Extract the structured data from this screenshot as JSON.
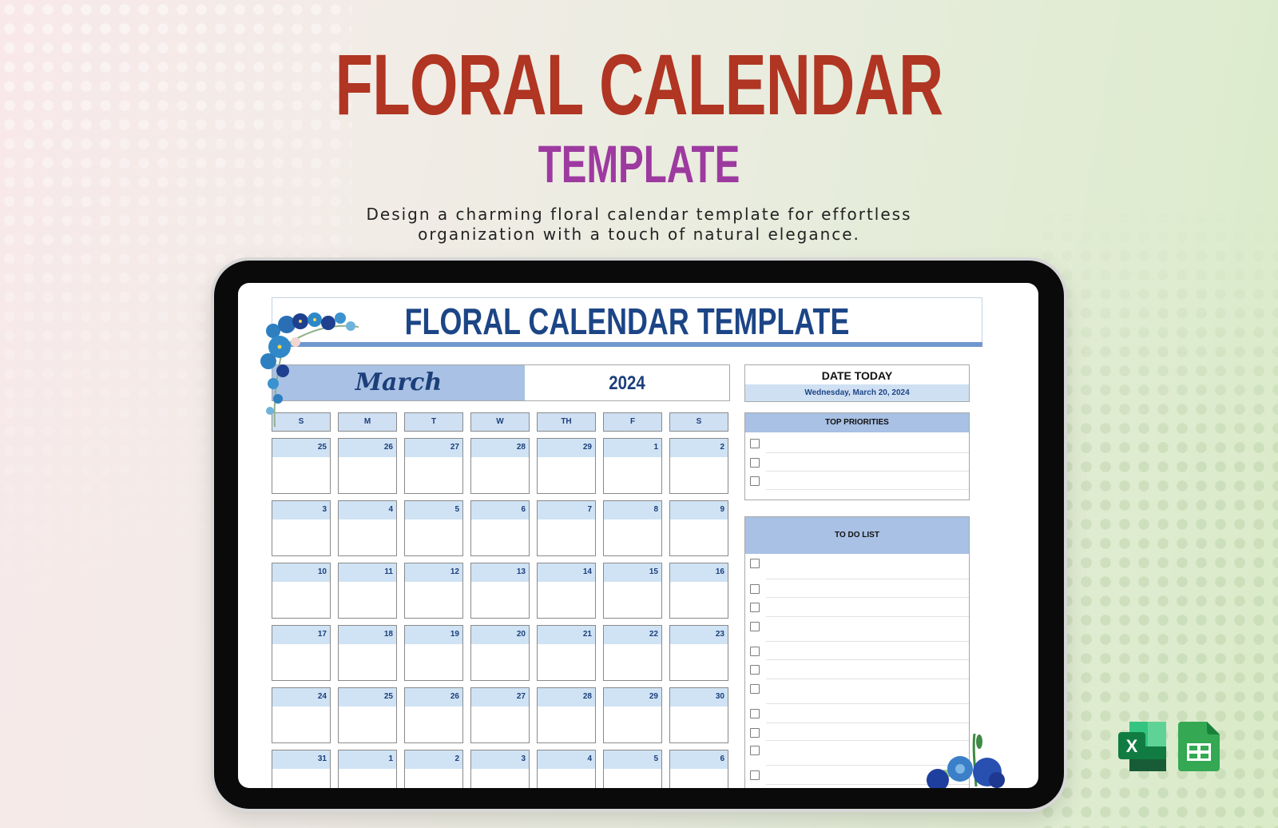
{
  "hero": {
    "title": "FLORAL CALENDAR",
    "subtitle": "TEMPLATE",
    "description_line1": "Design a charming floral calendar template for effortless",
    "description_line2": "organization with a touch of natural elegance."
  },
  "sheet": {
    "title": "FLORAL CALENDAR TEMPLATE",
    "month": "March",
    "year": "2024",
    "weekdays": [
      "S",
      "M",
      "T",
      "W",
      "TH",
      "F",
      "S"
    ],
    "weeks": [
      [
        "25",
        "26",
        "27",
        "28",
        "29",
        "1",
        "2"
      ],
      [
        "3",
        "4",
        "5",
        "6",
        "7",
        "8",
        "9"
      ],
      [
        "10",
        "11",
        "12",
        "13",
        "14",
        "15",
        "16"
      ],
      [
        "17",
        "18",
        "19",
        "20",
        "21",
        "22",
        "23"
      ],
      [
        "24",
        "25",
        "26",
        "27",
        "28",
        "29",
        "30"
      ],
      [
        "31",
        "1",
        "2",
        "3",
        "4",
        "5",
        "6"
      ]
    ],
    "date_today": {
      "label": "DATE TODAY",
      "value": "Wednesday, March 20, 2024"
    },
    "top_priorities": {
      "label": "TOP PRIORITIES",
      "items": [
        "",
        "",
        ""
      ]
    },
    "todo_list": {
      "label": "TO DO LIST",
      "items": [
        "",
        "",
        "",
        "",
        "",
        "",
        "",
        "",
        "",
        "",
        ""
      ]
    }
  },
  "apps": [
    {
      "name": "excel-icon",
      "letter": "X",
      "color": "#1f7244"
    },
    {
      "name": "google-sheets-icon",
      "color": "#34a853"
    }
  ],
  "colors": {
    "hero_title": "#b03522",
    "hero_subtitle": "#9d3aa0",
    "sheet_title": "#1c4586",
    "accent_blue": "#a8c1e4",
    "light_blue": "#cfe3f5"
  }
}
